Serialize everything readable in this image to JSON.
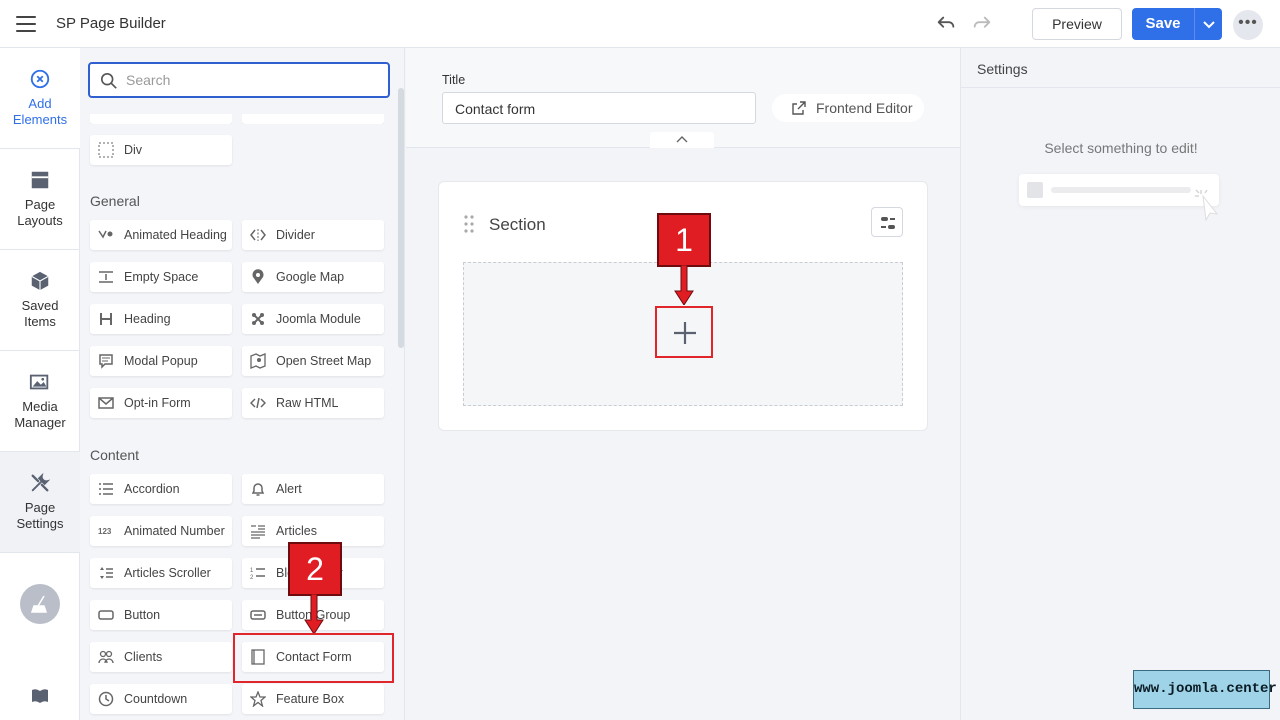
{
  "app": {
    "title": "SP Page Builder"
  },
  "toolbar": {
    "preview_label": "Preview",
    "save_label": "Save",
    "more_label": "•••"
  },
  "sidebar": {
    "items": [
      {
        "label": "Add Elements",
        "icon": "close-circle-icon",
        "active": true
      },
      {
        "label": "Page Layouts",
        "icon": "layout-icon"
      },
      {
        "label": "Saved Items",
        "icon": "box-icon"
      },
      {
        "label": "Media Manager",
        "icon": "media-icon"
      },
      {
        "label": "Page Settings",
        "icon": "wrench-icon"
      }
    ]
  },
  "addons_panel": {
    "search_placeholder": "Search",
    "ungrouped": [
      {
        "label": "Div",
        "icon": "dashed-square-icon"
      }
    ],
    "groups": [
      {
        "title": "General",
        "items": [
          {
            "label": "Animated Heading",
            "icon": "animated-heading-icon"
          },
          {
            "label": "Divider",
            "icon": "divider-icon"
          },
          {
            "label": "Empty Space",
            "icon": "empty-space-icon"
          },
          {
            "label": "Google Map",
            "icon": "map-pin-icon"
          },
          {
            "label": "Heading",
            "icon": "heading-icon"
          },
          {
            "label": "Joomla Module",
            "icon": "joomla-icon"
          },
          {
            "label": "Modal Popup",
            "icon": "popup-icon"
          },
          {
            "label": "Open Street Map",
            "icon": "street-map-icon"
          },
          {
            "label": "Opt-in Form",
            "icon": "envelope-icon"
          },
          {
            "label": "Raw HTML",
            "icon": "code-icon"
          }
        ]
      },
      {
        "title": "Content",
        "items": [
          {
            "label": "Accordion",
            "icon": "accordion-icon"
          },
          {
            "label": "Alert",
            "icon": "bell-icon"
          },
          {
            "label": "Animated Number",
            "icon": "number-icon"
          },
          {
            "label": "Articles",
            "icon": "articles-icon"
          },
          {
            "label": "Articles Scroller",
            "icon": "scroller-icon"
          },
          {
            "label": "Blog Flipper",
            "icon": "list-number-icon"
          },
          {
            "label": "Button",
            "icon": "button-icon"
          },
          {
            "label": "Button Group",
            "icon": "button-group-icon"
          },
          {
            "label": "Clients",
            "icon": "clients-icon"
          },
          {
            "label": "Contact Form",
            "icon": "contact-form-icon"
          },
          {
            "label": "Countdown",
            "icon": "clock-icon"
          },
          {
            "label": "Feature Box",
            "icon": "star-icon"
          }
        ]
      }
    ]
  },
  "canvas": {
    "title_label": "Title",
    "title_value": "Contact form",
    "frontend_editor_label": "Frontend Editor",
    "section_title": "Section"
  },
  "settings": {
    "title": "Settings",
    "hint": "Select something to edit!"
  },
  "annotations": {
    "step1": "1",
    "step2": "2"
  },
  "watermark": "www.joomla.center",
  "colors": {
    "primary": "#2f6fe8",
    "annotation": "#e11d24"
  }
}
